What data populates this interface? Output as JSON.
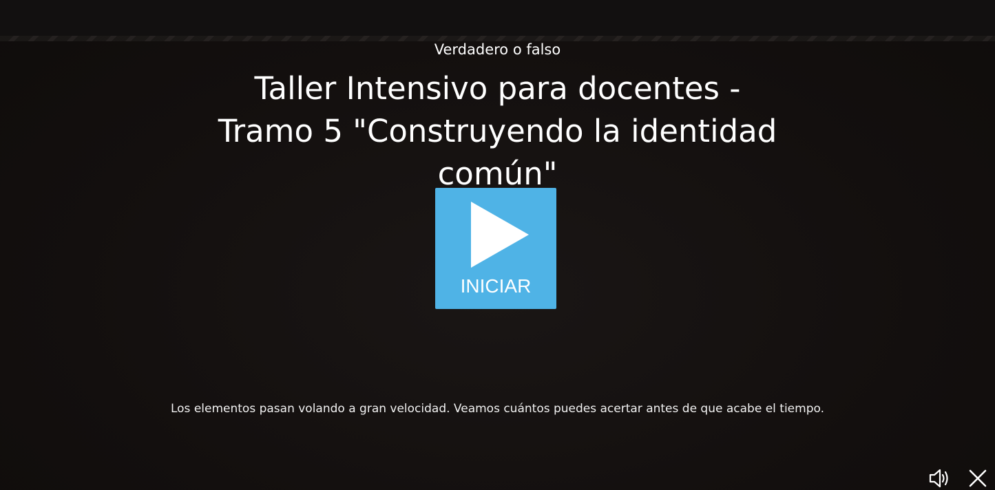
{
  "activity": {
    "kind": "Verdadero o falso",
    "title": "Taller Intensivo para docentes - Tramo 5 \"Construyendo la identidad común\"",
    "description": "Los elementos pasan volando a gran velocidad. Veamos cuántos puedes acertar antes de que acabe el tiempo."
  },
  "start_button": {
    "label": "INICIAR",
    "icon": "play-icon",
    "color": "#4fb3e6"
  },
  "controls": {
    "sound_icon": "speaker-icon",
    "close_icon": "close-icon"
  },
  "theme": {
    "background": "#120f0e",
    "text": "#ffffff"
  }
}
